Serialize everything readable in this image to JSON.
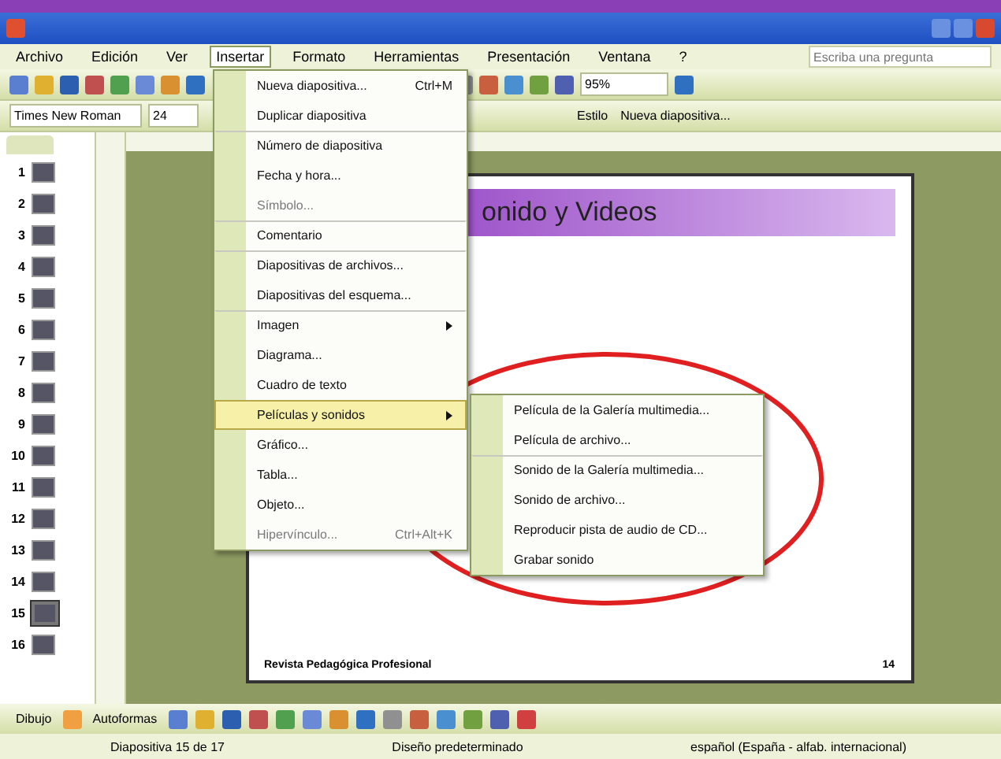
{
  "menu_bar": [
    {
      "label": "Archivo",
      "selected": false
    },
    {
      "label": "Edición",
      "selected": false
    },
    {
      "label": "Ver",
      "selected": false
    },
    {
      "label": "Insertar",
      "selected": true
    },
    {
      "label": "Formato",
      "selected": false
    },
    {
      "label": "Herramientas",
      "selected": false
    },
    {
      "label": "Presentación",
      "selected": false
    },
    {
      "label": "Ventana",
      "selected": false
    },
    {
      "label": "?",
      "selected": false
    }
  ],
  "help_box": {
    "placeholder": "Escriba una pregunta"
  },
  "standard_toolbar": {
    "zoom": "95%"
  },
  "format_toolbar": {
    "font": "Times New Roman",
    "size": "24",
    "design": "Estilo",
    "new_slide": "Nueva diapositiva..."
  },
  "slides": [
    {
      "number": "1",
      "selected": false
    },
    {
      "number": "2",
      "selected": false
    },
    {
      "number": "3",
      "selected": false
    },
    {
      "number": "4",
      "selected": false
    },
    {
      "number": "5",
      "selected": false
    },
    {
      "number": "6",
      "selected": false
    },
    {
      "number": "7",
      "selected": false
    },
    {
      "number": "8",
      "selected": false
    },
    {
      "number": "9",
      "selected": false
    },
    {
      "number": "10",
      "selected": false
    },
    {
      "number": "11",
      "selected": false
    },
    {
      "number": "12",
      "selected": false
    },
    {
      "number": "13",
      "selected": false
    },
    {
      "number": "14",
      "selected": false
    },
    {
      "number": "15",
      "selected": true
    },
    {
      "number": "16",
      "selected": false
    }
  ],
  "slide": {
    "title": "onido y Videos",
    "footer": "Revista Pedagógica Profesional",
    "page": "14"
  },
  "insert_menu": [
    {
      "label": "Nueva diapositiva...",
      "shortcut": "Ctrl+M",
      "separator_before": false,
      "disabled": false,
      "selected": false,
      "submenu": false
    },
    {
      "label": "Duplicar diapositiva",
      "separator_before": false,
      "disabled": false,
      "selected": false,
      "submenu": false
    },
    {
      "label": "Número de diapositiva",
      "separator_before": true,
      "disabled": false,
      "selected": false,
      "submenu": false
    },
    {
      "label": "Fecha y hora...",
      "separator_before": false,
      "disabled": false,
      "selected": false,
      "submenu": false
    },
    {
      "label": "Símbolo...",
      "separator_before": false,
      "disabled": true,
      "selected": false,
      "submenu": false
    },
    {
      "label": "Comentario",
      "separator_before": true,
      "disabled": false,
      "selected": false,
      "submenu": false
    },
    {
      "label": "Diapositivas de archivos...",
      "separator_before": true,
      "disabled": false,
      "selected": false,
      "submenu": false
    },
    {
      "label": "Diapositivas del esquema...",
      "separator_before": false,
      "disabled": false,
      "selected": false,
      "submenu": false
    },
    {
      "label": "Imagen",
      "separator_before": true,
      "disabled": false,
      "selected": false,
      "submenu": true
    },
    {
      "label": "Diagrama...",
      "separator_before": false,
      "disabled": false,
      "selected": false,
      "submenu": false
    },
    {
      "label": "Cuadro de texto",
      "separator_before": false,
      "disabled": false,
      "selected": false,
      "submenu": false
    },
    {
      "label": "Películas y sonidos",
      "separator_before": false,
      "disabled": false,
      "selected": true,
      "submenu": true
    },
    {
      "label": "Gráfico...",
      "separator_before": false,
      "disabled": false,
      "selected": false,
      "submenu": false
    },
    {
      "label": "Tabla...",
      "separator_before": false,
      "disabled": false,
      "selected": false,
      "submenu": false
    },
    {
      "label": "Objeto...",
      "separator_before": false,
      "disabled": false,
      "selected": false,
      "submenu": false
    },
    {
      "label": "Hipervínculo...",
      "shortcut": "Ctrl+Alt+K",
      "separator_before": false,
      "disabled": true,
      "selected": false,
      "submenu": false
    }
  ],
  "media_submenu": [
    {
      "label": "Película de la Galería multimedia...",
      "separator_before": false
    },
    {
      "label": "Película de archivo...",
      "separator_before": false
    },
    {
      "label": "Sonido de la Galería multimedia...",
      "separator_before": true
    },
    {
      "label": "Sonido de archivo...",
      "separator_before": false
    },
    {
      "label": "Reproducir pista de audio de CD...",
      "separator_before": false
    },
    {
      "label": "Grabar sonido",
      "separator_before": false
    }
  ],
  "drawing_toolbar": {
    "draw": "Dibujo",
    "autoshapes": "Autoformas"
  },
  "status_bar": [
    "Diapositiva 15 de 17",
    "Diseño predeterminado",
    "español (España - alfab. internacional)"
  ]
}
